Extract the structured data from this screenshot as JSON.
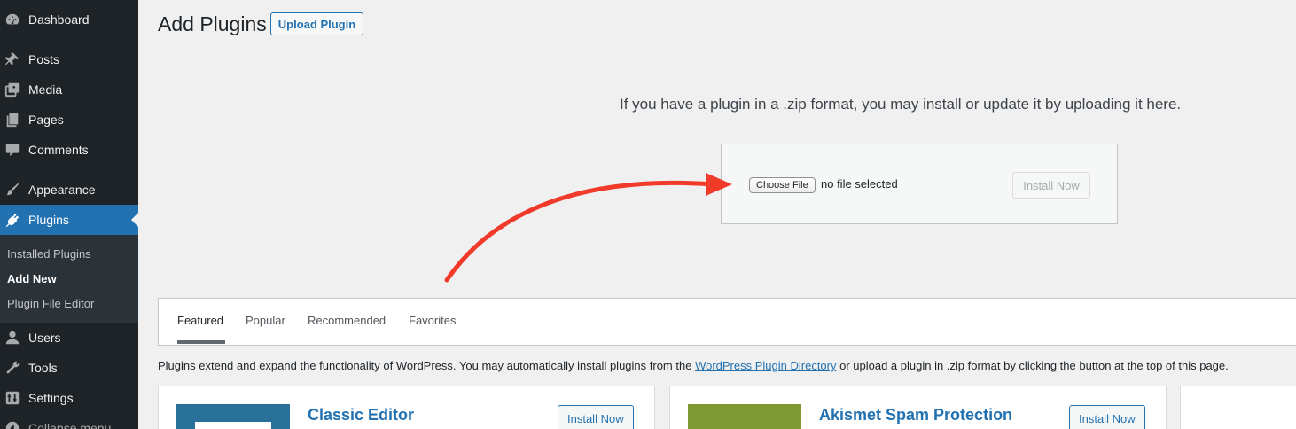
{
  "sidebar": {
    "items": {
      "dashboard": "Dashboard",
      "posts": "Posts",
      "media": "Media",
      "pages": "Pages",
      "comments": "Comments",
      "appearance": "Appearance",
      "plugins": "Plugins",
      "users": "Users",
      "tools": "Tools",
      "settings": "Settings",
      "collapse": "Collapse menu"
    },
    "submenu": {
      "installed": "Installed Plugins",
      "add_new": "Add New",
      "editor": "Plugin File Editor"
    }
  },
  "header": {
    "title": "Add Plugins",
    "upload_button": "Upload Plugin"
  },
  "upload": {
    "help_text": "If you have a plugin in a .zip format, you may install or update it by uploading it here.",
    "choose_file": "Choose File",
    "file_status": "no file selected",
    "install_button": "Install Now"
  },
  "tabs": {
    "featured": "Featured",
    "popular": "Popular",
    "recommended": "Recommended",
    "favorites": "Favorites"
  },
  "description": {
    "before": "Plugins extend and expand the functionality of WordPress. You may automatically install plugins from the ",
    "link": "WordPress Plugin Directory",
    "after": " or upload a plugin in .zip format by clicking the button at the top of this page."
  },
  "cards": {
    "classic": {
      "title": "Classic Editor",
      "install": "Install Now"
    },
    "akismet": {
      "title": "Akismet Spam Protection",
      "install": "Install Now"
    }
  },
  "colors": {
    "sidebar_bg": "#1d2327",
    "accent": "#2271b1",
    "arrow": "#f23a2a",
    "classic_thumb": "#2a7199",
    "akismet_thumb": "#7f9a34"
  }
}
